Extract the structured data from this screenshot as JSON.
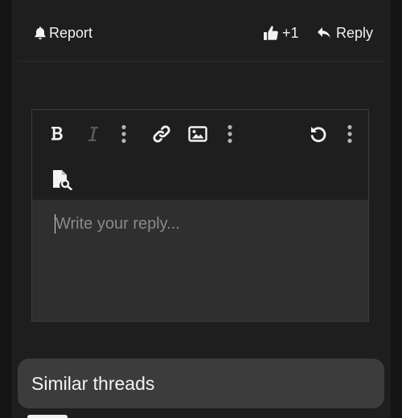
{
  "post_actions": {
    "report_label": "Report",
    "like_label": "+1",
    "reply_label": "Reply"
  },
  "editor": {
    "placeholder": "Write your reply...",
    "toolbar": {
      "bold": "bold-icon",
      "italic": "italic-icon",
      "more_text": "vertical-ellipsis-icon",
      "link": "link-icon",
      "image": "image-icon",
      "more_insert": "vertical-ellipsis-icon",
      "undo": "undo-icon",
      "more_options": "vertical-ellipsis-icon",
      "preview": "document-search-icon"
    }
  },
  "similar_threads": {
    "title": "Similar threads"
  },
  "colors": {
    "background": "#1e1e1e",
    "editor_area": "#2f2f2f",
    "text": "#f2f2f2",
    "placeholder": "#8a8a8a",
    "disabled_icon": "#5a5a5a",
    "card": "#3c3c3c"
  }
}
